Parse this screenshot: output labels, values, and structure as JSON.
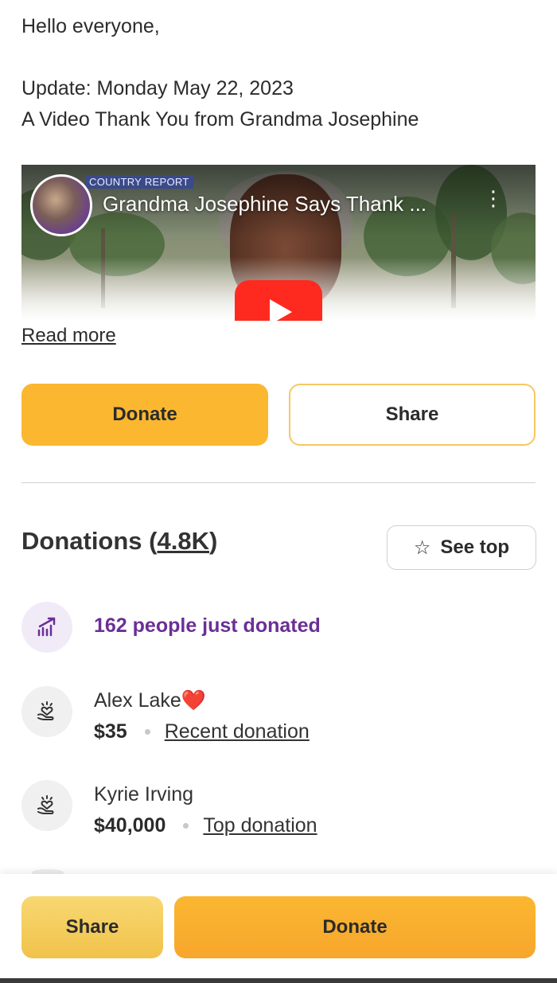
{
  "story": {
    "greeting": "Hello everyone,",
    "update": "Update: Monday May 22, 2023",
    "subtitle": "A Video Thank You from Grandma Josephine"
  },
  "video": {
    "title": "Grandma Josephine Says Thank ...",
    "channel_badge": "COUNTRY REPORT",
    "play_color": "#ff2a1f"
  },
  "read_more": "Read more",
  "actions": {
    "donate_label": "Donate",
    "share_label": "Share"
  },
  "donations": {
    "heading": "Donations (",
    "count": "4.8K",
    "heading_close": ")",
    "see_top_label": "See top",
    "recent_summary": "162 people just donated",
    "donors": [
      {
        "name": "Alex Lake❤️",
        "amount": "$35",
        "tag": "Recent donation"
      },
      {
        "name": "Kyrie Irving",
        "amount": "$40,000",
        "tag": "Top donation"
      }
    ]
  },
  "bottom_bar": {
    "share_label": "Share",
    "donate_label": "Donate"
  },
  "colors": {
    "accent": "#fbb730",
    "purple": "#6b2f95"
  }
}
